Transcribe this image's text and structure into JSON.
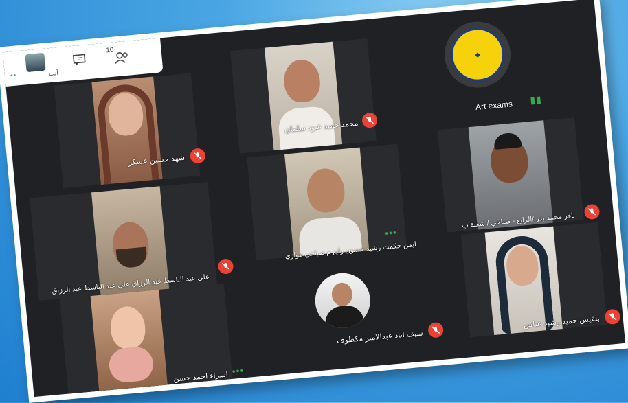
{
  "topbar": {
    "participant_count": "10",
    "you_label": "أنت"
  },
  "meeting": {
    "title": "Art exams"
  },
  "participants": [
    {
      "name": "شهد حسين عسكر"
    },
    {
      "name": "محمد حميد عبود سلمان"
    },
    {
      "name": "باقر محمد بدر /الرابع - صباحي / شعبة ب"
    },
    {
      "name": "علي عبد الباسط عبد الرزاق علي عبد الباسط عبد الرزاق"
    },
    {
      "name": "ايمن حكمت رشيد حسون رابع م صباحي موازي"
    },
    {
      "name": "بلقيس حميد رشيد عباس"
    },
    {
      "name": "اسراء احمد حسن"
    },
    {
      "name": "سيف اياد عبدالامير مكطوف"
    }
  ],
  "colors": {
    "mic_off": "#ea4335",
    "speaking": "#34a853",
    "background": "#202124"
  }
}
